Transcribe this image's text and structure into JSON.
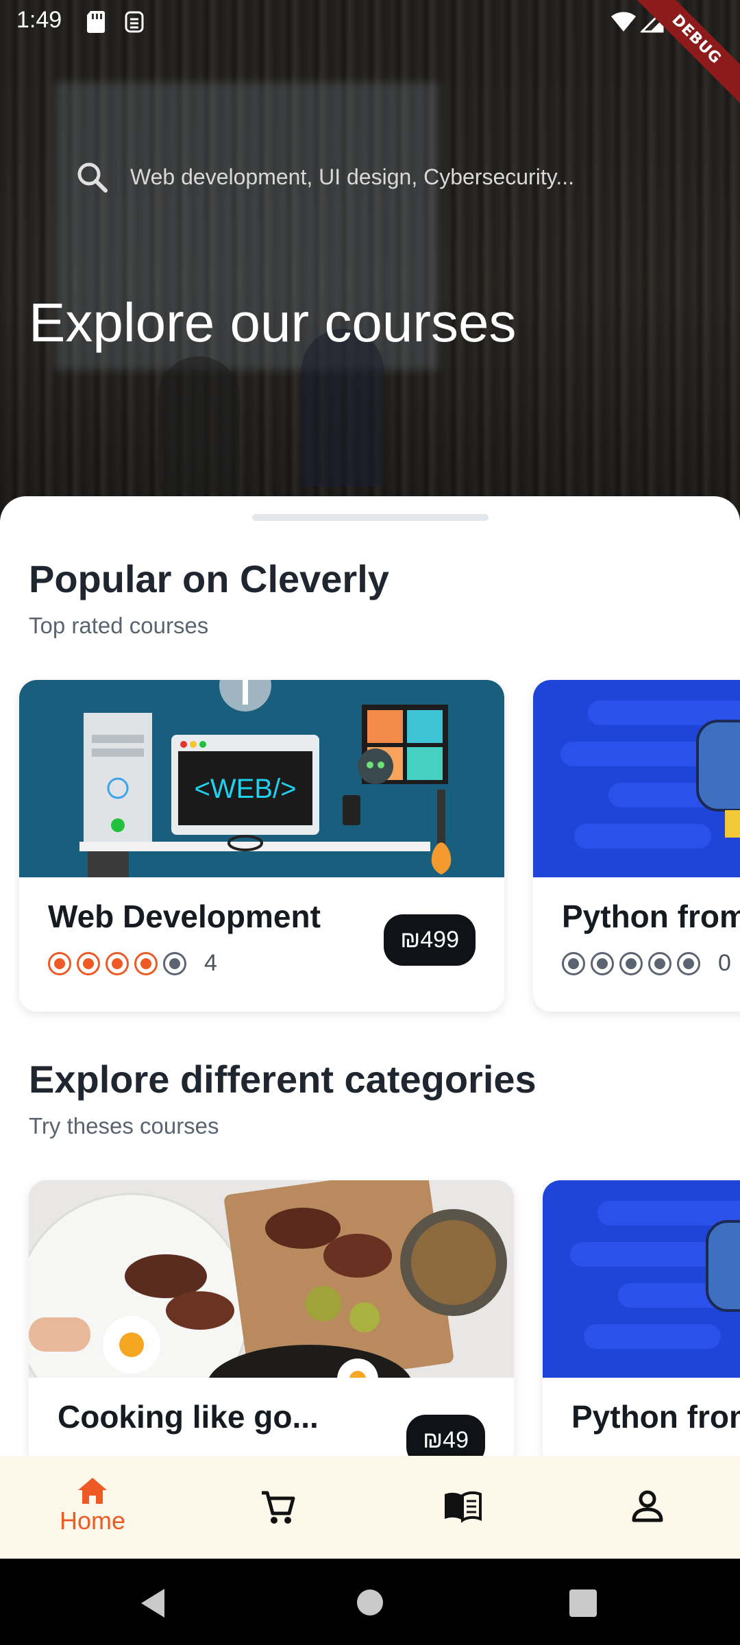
{
  "status_bar": {
    "time": "1:49",
    "icons": [
      "sd-card-icon",
      "sim-icon",
      "wifi-icon",
      "signal-icon",
      "battery-icon"
    ],
    "debug_banner": "DEBUG"
  },
  "hero": {
    "search_placeholder": "Web development, UI design, Cybersecurity...",
    "title": "Explore our courses"
  },
  "popular": {
    "title": "Popular on Cleverly",
    "subtitle": "Top rated courses",
    "courses": [
      {
        "name": "Web Development",
        "rating": 4,
        "rating_text": "4",
        "price": "₪499",
        "thumb_text": "<WEB/>"
      },
      {
        "name": "Python from",
        "rating": 0,
        "rating_text": "0"
      }
    ]
  },
  "categories": {
    "title": "Explore different categories",
    "subtitle": "Try theses courses",
    "courses": [
      {
        "name": "Cooking like go...",
        "price": "₪49"
      },
      {
        "name": "Python from"
      }
    ]
  },
  "bottom_nav": {
    "items": [
      {
        "label": "Home",
        "icon": "home-icon",
        "active": true
      },
      {
        "label": "",
        "icon": "cart-icon",
        "active": false
      },
      {
        "label": "",
        "icon": "book-icon",
        "active": false
      },
      {
        "label": "",
        "icon": "profile-icon",
        "active": false
      }
    ]
  },
  "colors": {
    "accent": "#ee5a24",
    "dark": "#0f1216",
    "nav_bg": "#fdf8e9",
    "python_blue": "#1f44d8"
  }
}
